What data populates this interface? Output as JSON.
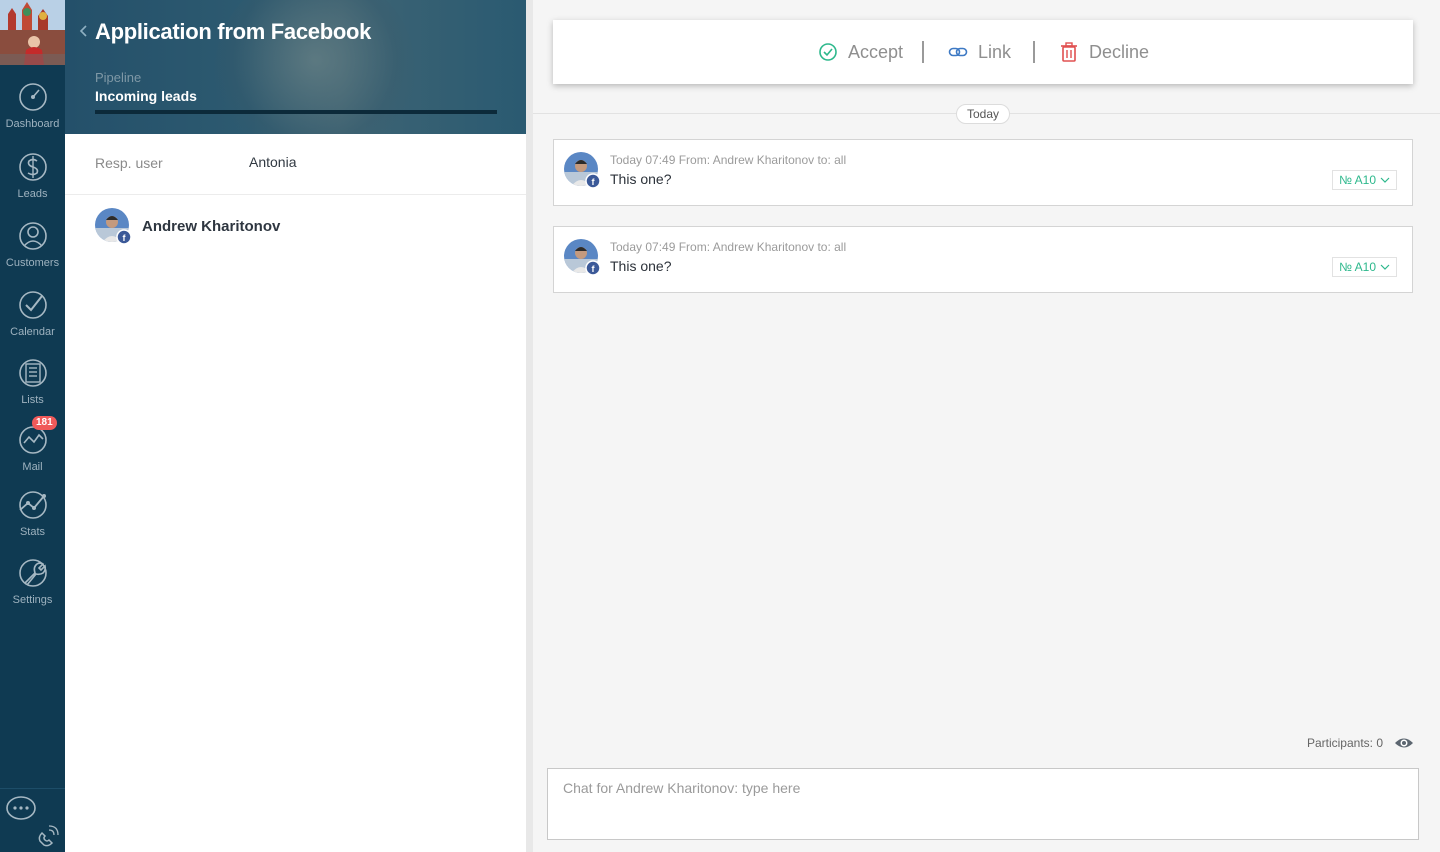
{
  "nav": {
    "items": [
      {
        "label": "Dashboard",
        "icon": "dashboard-icon"
      },
      {
        "label": "Leads",
        "icon": "dollar-icon"
      },
      {
        "label": "Customers",
        "icon": "customers-icon"
      },
      {
        "label": "Calendar",
        "icon": "check-icon"
      },
      {
        "label": "Lists",
        "icon": "list-icon"
      },
      {
        "label": "Mail",
        "icon": "mail-icon",
        "badge": "181"
      },
      {
        "label": "Stats",
        "icon": "stats-icon"
      },
      {
        "label": "Settings",
        "icon": "wrench-icon"
      }
    ],
    "bottom": {
      "chat_icon": "chat-icon",
      "phone_icon": "phone-icon"
    }
  },
  "lead": {
    "title": "Application from Facebook",
    "pipeline_label": "Pipeline",
    "pipeline_value": "Incoming leads",
    "resp_label": "Resp. user",
    "resp_value": "Antonia",
    "contact_name": "Andrew Kharitonov"
  },
  "actions": {
    "accept": "Accept",
    "link": "Link",
    "decline": "Decline"
  },
  "feed": {
    "day_label": "Today",
    "messages": [
      {
        "meta": "Today 07:49 From: Andrew Kharitonov to: all",
        "text": "This one?",
        "tag": "№ A10"
      },
      {
        "meta": "Today 07:49 From: Andrew Kharitonov to: all",
        "text": "This one?",
        "tag": "№ A10"
      }
    ],
    "participants": "Participants: 0"
  },
  "chat": {
    "placeholder": "Chat for Andrew Kharitonov: type here"
  },
  "colors": {
    "nav_bg": "#0f3a52",
    "accent_green": "#2db88c",
    "link_blue": "#3d79c4",
    "decline_red": "#e05050",
    "badge_red": "#f05a5a",
    "facebook_blue": "#3b5998"
  }
}
